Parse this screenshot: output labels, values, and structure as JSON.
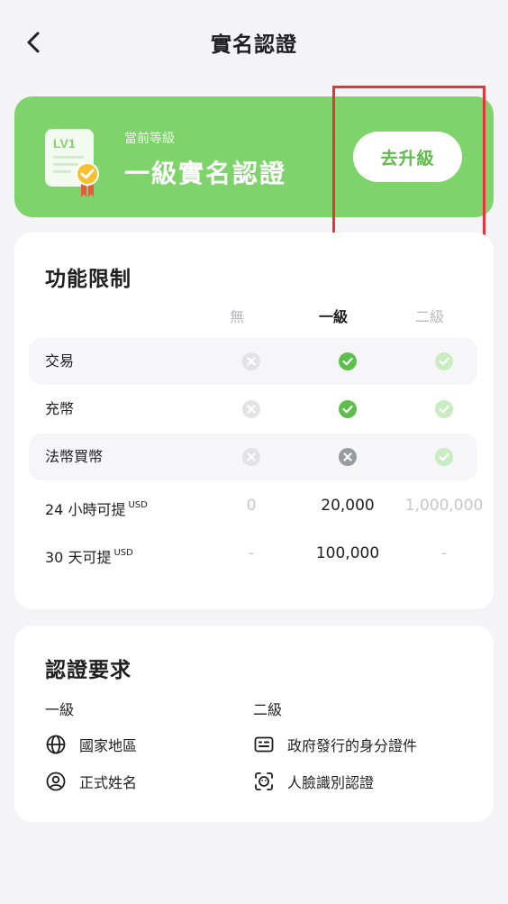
{
  "header": {
    "title": "實名認證"
  },
  "level": {
    "badge_text": "LV1",
    "caption": "當前等級",
    "name": "一級實名認證",
    "upgrade_label": "去升級"
  },
  "limits": {
    "title": "功能限制",
    "columns": [
      "無",
      "一級",
      "二級"
    ],
    "rows": [
      {
        "label": "交易",
        "unit": "",
        "values": [
          "cross",
          "check",
          "check"
        ]
      },
      {
        "label": "充幣",
        "unit": "",
        "values": [
          "cross",
          "check",
          "check"
        ]
      },
      {
        "label": "法幣買幣",
        "unit": "",
        "values": [
          "cross",
          "cross-dark",
          "check"
        ]
      },
      {
        "label": "24 小時可提",
        "unit": "USD",
        "values": [
          "0",
          "20,000",
          "1,000,000"
        ]
      },
      {
        "label": "30 天可提",
        "unit": "USD",
        "values": [
          "-",
          "100,000",
          "-"
        ]
      }
    ]
  },
  "requirements": {
    "title": "認證要求",
    "level1_label": "一級",
    "level2_label": "二級",
    "level1_items": [
      {
        "icon": "globe-icon",
        "label": "國家地區"
      },
      {
        "icon": "user-circle-icon",
        "label": "正式姓名"
      }
    ],
    "level2_items": [
      {
        "icon": "id-card-icon",
        "label": "政府發行的身分證件"
      },
      {
        "icon": "face-scan-icon",
        "label": "人臉識別認證"
      }
    ]
  },
  "colors": {
    "accent_green": "#7fd36b",
    "check_green": "#5cbf4c",
    "check_light": "#c9ecc0",
    "cross_light": "#e3e3e6",
    "cross_dark": "#9a9aa2",
    "highlight_red": "#e5343b"
  }
}
